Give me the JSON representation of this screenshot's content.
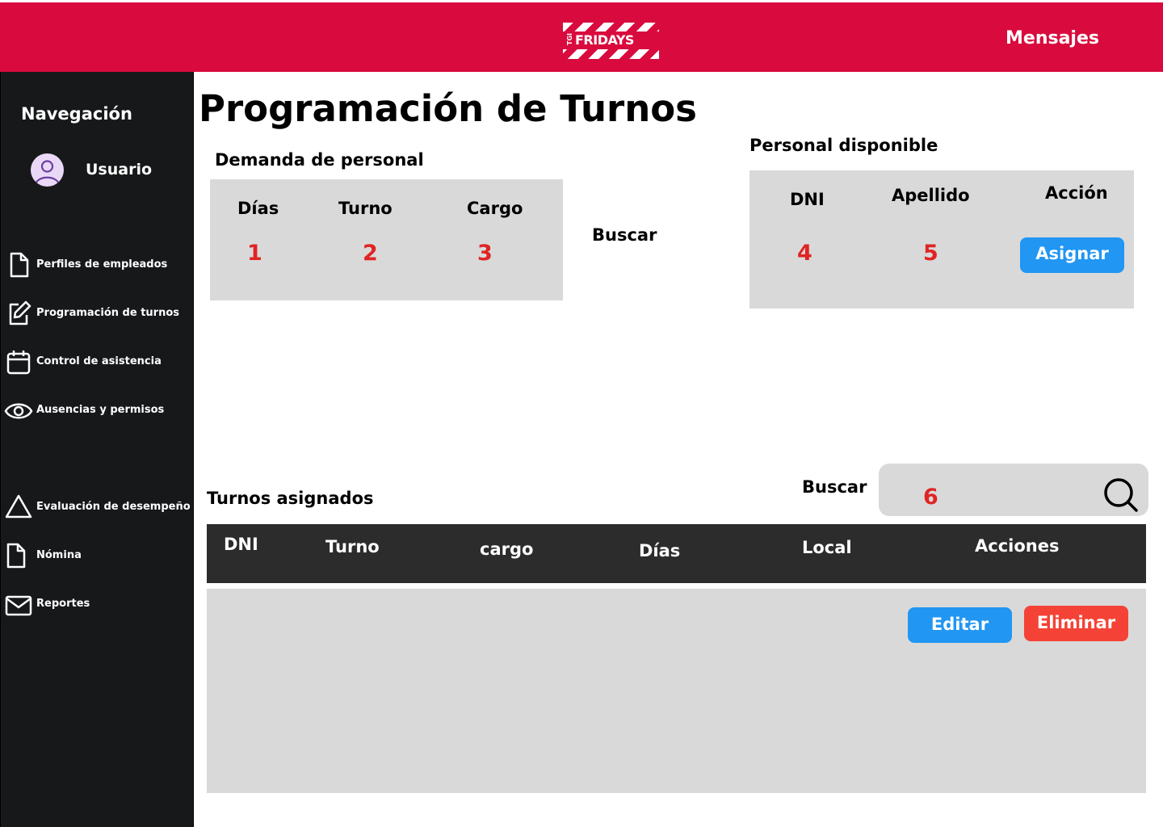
{
  "header": {
    "logo_tgi": "TGI",
    "logo_brand": "FRIDAYS",
    "messages_label": "Mensajes"
  },
  "sidebar": {
    "title": "Navegación",
    "user_name": "Usuario",
    "items": [
      {
        "label": "Perfiles de empleados",
        "icon": "document-icon"
      },
      {
        "label": "Programación de turnos",
        "icon": "edit-icon"
      },
      {
        "label": "Control de asistencia",
        "icon": "calendar-icon"
      },
      {
        "label": "Ausencias y permisos",
        "icon": "eye-icon"
      },
      {
        "label": "Evaluación de desempeño",
        "icon": "triangle-icon"
      },
      {
        "label": "Nómina",
        "icon": "document-icon"
      },
      {
        "label": "Reportes",
        "icon": "mail-icon"
      }
    ]
  },
  "page": {
    "title": "Programación de Turnos"
  },
  "demand": {
    "title": "Demanda de personal",
    "headers": [
      "Días",
      "Turno",
      "Cargo"
    ],
    "values": [
      "1",
      "2",
      "3"
    ]
  },
  "search_label": "Buscar",
  "available": {
    "title": "Personal disponible",
    "headers": [
      "DNI",
      "Apellido",
      "Acción"
    ],
    "values": [
      "4",
      "5"
    ],
    "assign_label": "Asignar"
  },
  "assigned": {
    "title": "Turnos asignados",
    "search_label": "Buscar",
    "search_value": "6",
    "headers": [
      "DNI",
      "Turno",
      "cargo",
      "Días",
      "Local",
      "Acciones"
    ],
    "edit_label": "Editar",
    "delete_label": "Eliminar"
  },
  "colors": {
    "brand": "#d90b3e",
    "sidebar": "#17181a",
    "primary": "#2196f3",
    "danger": "#f44336",
    "number": "#e02424"
  }
}
